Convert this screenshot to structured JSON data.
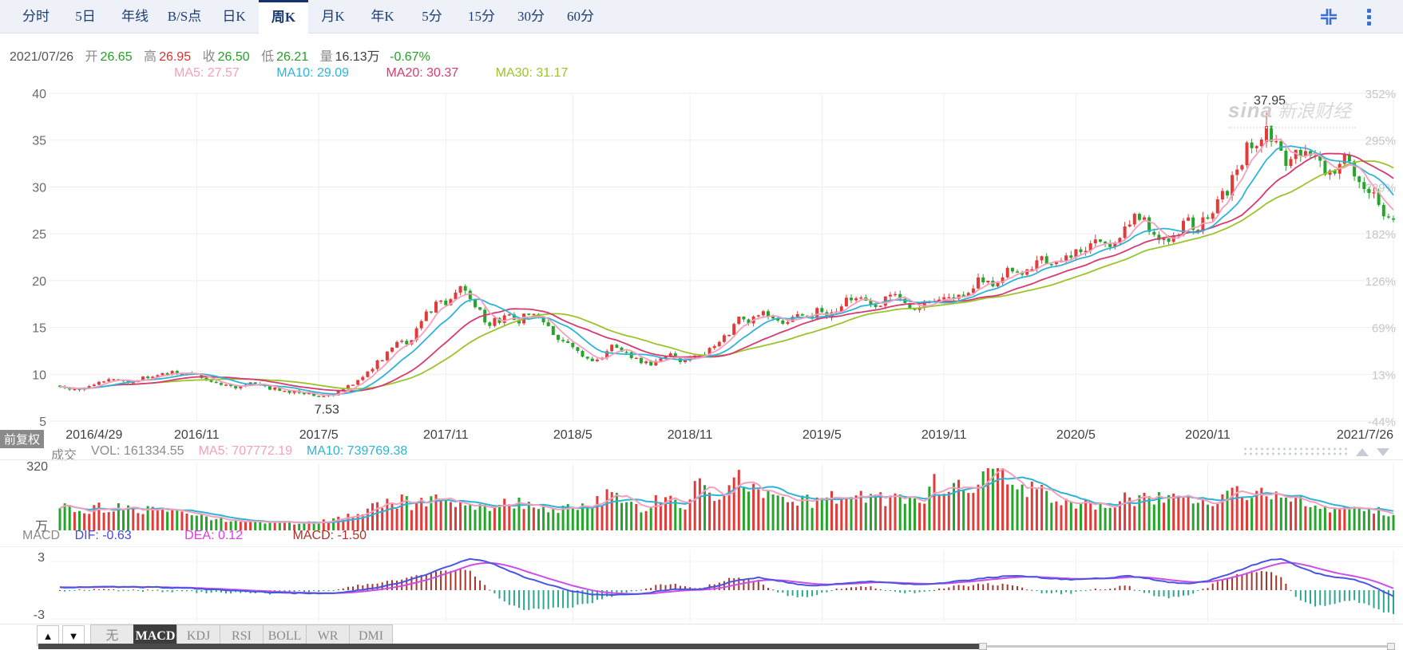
{
  "tab_bar": {
    "tabs": [
      {
        "key": "time",
        "label": "分时",
        "active": false
      },
      {
        "key": "5d",
        "label": "5日",
        "active": false
      },
      {
        "key": "yearline",
        "label": "年线",
        "active": false
      },
      {
        "key": "bs-point",
        "label": "B/S点",
        "active": false
      },
      {
        "key": "daily-k",
        "label": "日K",
        "active": false
      },
      {
        "key": "weekly-k",
        "label": "周K",
        "active": true
      },
      {
        "key": "monthly-k",
        "label": "月K",
        "active": false
      },
      {
        "key": "yearly-k",
        "label": "年K",
        "active": false
      },
      {
        "key": "5min",
        "label": "5分",
        "active": false
      },
      {
        "key": "15min",
        "label": "15分",
        "active": false
      },
      {
        "key": "30min",
        "label": "30分",
        "active": false
      },
      {
        "key": "60min",
        "label": "60分",
        "active": false
      }
    ]
  },
  "quote": {
    "date": "2021/07/26",
    "open_label": "开",
    "open": "26.65",
    "high_label": "高",
    "high": "26.95",
    "close_label": "收",
    "close": "26.50",
    "low_label": "低",
    "low": "26.21",
    "vol_label": "量",
    "vol": "16.13万",
    "change": "-0.67%"
  },
  "ma_legend": {
    "ma5": "MA5: 27.57",
    "ma10": "MA10: 29.09",
    "ma20": "MA20: 30.37",
    "ma30": "MA30: 31.17"
  },
  "adjust_badge": "前复权",
  "watermark": {
    "brand": "sina",
    "name": "新浪财经"
  },
  "volume_pane": {
    "title": "成交",
    "vol": "VOL: 161334.55",
    "ma5": "MA5: 707772.19",
    "ma10": "MA10: 739769.38",
    "axis_top": "320",
    "unit": "万"
  },
  "macd_pane": {
    "title": "MACD",
    "dif": "DIF: -0.63",
    "dea": "DEA: 0.12",
    "macd": "MACD: -1.50",
    "axis_top": "3",
    "axis_bottom": "-3"
  },
  "indicator_bar": {
    "up": "▲",
    "down": "▼",
    "items": [
      {
        "key": "none",
        "label": "无",
        "active": false
      },
      {
        "key": "macd",
        "label": "MACD",
        "active": true
      },
      {
        "key": "kdj",
        "label": "KDJ",
        "active": false
      },
      {
        "key": "rsi",
        "label": "RSI",
        "active": false
      },
      {
        "key": "boll",
        "label": "BOLL",
        "active": false
      },
      {
        "key": "wr",
        "label": "WR",
        "active": false
      },
      {
        "key": "dmi",
        "label": "DMI",
        "active": false
      }
    ]
  },
  "colors": {
    "up": "#e13b3a",
    "down": "#25a52b",
    "ma5": "#f4a0bd",
    "ma10": "#2db4d8",
    "ma20": "#d63a72",
    "ma30": "#9cc32a",
    "dif_line": "#4a55e0",
    "dea_line": "#cc4fe6",
    "hist_pos": "#a8352a",
    "hist_neg": "#2aa78c",
    "grid": "#ededed",
    "vgrid": "#efefef"
  },
  "chart_data": {
    "type": "candlestick",
    "title": "周K weekly candlestick with volume and MACD panes",
    "weeks": 274,
    "last_candle": {
      "date": "2021/07/26",
      "open": 26.65,
      "high": 26.95,
      "low": 26.21,
      "close": 26.5,
      "volume_wan": 16.13,
      "change_pct": -0.67
    },
    "ma_values": {
      "MA5": 27.57,
      "MA10": 29.09,
      "MA20": 30.37,
      "MA30": 31.17
    },
    "macd_values": {
      "DIF": -0.63,
      "DEA": 0.12,
      "MACD": -1.5
    },
    "volume_values": {
      "VOL": 161334.55,
      "MA5": 707772.19,
      "MA10": 739769.38
    },
    "y_axis": [
      {
        "price": 40,
        "pct": "352%"
      },
      {
        "price": 35,
        "pct": "295%"
      },
      {
        "price": 30,
        "pct": "239%"
      },
      {
        "price": 25,
        "pct": "182%"
      },
      {
        "price": 20,
        "pct": "126%"
      },
      {
        "price": 15,
        "pct": "69%"
      },
      {
        "price": 10,
        "pct": "13%"
      },
      {
        "price": 5,
        "pct": "-44%"
      }
    ],
    "x_labels": [
      {
        "label": "2016/4/29",
        "week": 7
      },
      {
        "label": "2016/11",
        "week": 28
      },
      {
        "label": "2017/5",
        "week": 53
      },
      {
        "label": "2017/11",
        "week": 79
      },
      {
        "label": "2018/5",
        "week": 105
      },
      {
        "label": "2018/11",
        "week": 129
      },
      {
        "label": "2019/5",
        "week": 156
      },
      {
        "label": "2019/11",
        "week": 181
      },
      {
        "label": "2020/5",
        "week": 208
      },
      {
        "label": "2020/11",
        "week": 235
      },
      {
        "label": "2021/7/26",
        "week": 273
      }
    ],
    "grid_weeks": [
      28,
      53,
      79,
      105,
      129,
      156,
      181,
      208,
      235,
      273
    ],
    "annotations": {
      "high": {
        "label": "37.95",
        "price": 37.95,
        "week": 247
      },
      "low": {
        "label": "7.53",
        "price": 7.53,
        "week": 54
      }
    },
    "price_anchors": [
      [
        0,
        8.8
      ],
      [
        3,
        8.4
      ],
      [
        6,
        8.9
      ],
      [
        9,
        9.3
      ],
      [
        12,
        9.6
      ],
      [
        15,
        9.3
      ],
      [
        18,
        9.7
      ],
      [
        21,
        10.0
      ],
      [
        24,
        10.1
      ],
      [
        27,
        10.0
      ],
      [
        30,
        9.5
      ],
      [
        33,
        9.0
      ],
      [
        36,
        8.7
      ],
      [
        39,
        8.9
      ],
      [
        42,
        8.5
      ],
      [
        45,
        8.3
      ],
      [
        48,
        8.2
      ],
      [
        51,
        7.9
      ],
      [
        54,
        7.7
      ],
      [
        56,
        7.9
      ],
      [
        58,
        8.4
      ],
      [
        60,
        9.0
      ],
      [
        62,
        9.8
      ],
      [
        64,
        10.8
      ],
      [
        66,
        11.6
      ],
      [
        68,
        12.8
      ],
      [
        70,
        13.6
      ],
      [
        71,
        13.1
      ],
      [
        73,
        15.0
      ],
      [
        75,
        16.6
      ],
      [
        77,
        17.6
      ],
      [
        79,
        17.2
      ],
      [
        81,
        19.2
      ],
      [
        82,
        19.8
      ],
      [
        84,
        18.3
      ],
      [
        86,
        16.6
      ],
      [
        88,
        15.3
      ],
      [
        90,
        15.9
      ],
      [
        92,
        16.3
      ],
      [
        94,
        15.7
      ],
      [
        95,
        16.9
      ],
      [
        97,
        16.6
      ],
      [
        99,
        15.6
      ],
      [
        101,
        14.2
      ],
      [
        103,
        13.3
      ],
      [
        105,
        12.7
      ],
      [
        107,
        12.1
      ],
      [
        109,
        11.6
      ],
      [
        111,
        12.1
      ],
      [
        113,
        13.3
      ],
      [
        115,
        12.4
      ],
      [
        117,
        11.7
      ],
      [
        119,
        11.2
      ],
      [
        121,
        10.9
      ],
      [
        123,
        11.9
      ],
      [
        125,
        12.2
      ],
      [
        127,
        11.6
      ],
      [
        129,
        11.7
      ],
      [
        131,
        11.9
      ],
      [
        133,
        12.6
      ],
      [
        135,
        13.4
      ],
      [
        137,
        14.6
      ],
      [
        139,
        16.0
      ],
      [
        141,
        15.4
      ],
      [
        143,
        16.7
      ],
      [
        145,
        16.1
      ],
      [
        147,
        15.3
      ],
      [
        149,
        15.8
      ],
      [
        151,
        16.5
      ],
      [
        153,
        16.1
      ],
      [
        155,
        16.7
      ],
      [
        157,
        16.3
      ],
      [
        159,
        17.0
      ],
      [
        161,
        17.7
      ],
      [
        163,
        18.4
      ],
      [
        165,
        17.9
      ],
      [
        167,
        17.3
      ],
      [
        169,
        17.8
      ],
      [
        171,
        18.2
      ],
      [
        173,
        17.8
      ],
      [
        175,
        17.2
      ],
      [
        177,
        17.6
      ],
      [
        179,
        18.1
      ],
      [
        181,
        17.9
      ],
      [
        183,
        18.1
      ],
      [
        185,
        18.9
      ],
      [
        187,
        19.5
      ],
      [
        189,
        20.2
      ],
      [
        191,
        19.7
      ],
      [
        193,
        20.7
      ],
      [
        195,
        21.4
      ],
      [
        197,
        20.9
      ],
      [
        199,
        21.7
      ],
      [
        201,
        22.4
      ],
      [
        203,
        21.7
      ],
      [
        205,
        22.2
      ],
      [
        207,
        23.0
      ],
      [
        209,
        22.8
      ],
      [
        211,
        23.8
      ],
      [
        213,
        24.8
      ],
      [
        215,
        24.2
      ],
      [
        217,
        25.1
      ],
      [
        219,
        26.0
      ],
      [
        221,
        26.8
      ],
      [
        223,
        25.8
      ],
      [
        225,
        24.8
      ],
      [
        227,
        24.1
      ],
      [
        229,
        25.3
      ],
      [
        231,
        26.3
      ],
      [
        233,
        25.9
      ],
      [
        235,
        26.9
      ],
      [
        237,
        28.3
      ],
      [
        239,
        29.8
      ],
      [
        241,
        31.8
      ],
      [
        243,
        33.8
      ],
      [
        245,
        35.3
      ],
      [
        247,
        36.8
      ],
      [
        249,
        34.2
      ],
      [
        251,
        31.8
      ],
      [
        253,
        33.2
      ],
      [
        255,
        34.3
      ],
      [
        257,
        33.0
      ],
      [
        259,
        31.4
      ],
      [
        261,
        31.9
      ],
      [
        263,
        32.6
      ],
      [
        265,
        31.3
      ],
      [
        267,
        29.8
      ],
      [
        269,
        28.8
      ],
      [
        271,
        27.4
      ],
      [
        273,
        26.5
      ]
    ],
    "volume_axis_max": 320,
    "volume_anchors": [
      [
        0,
        130
      ],
      [
        6,
        110
      ],
      [
        12,
        120
      ],
      [
        18,
        100
      ],
      [
        24,
        95
      ],
      [
        27,
        75
      ],
      [
        32,
        55
      ],
      [
        38,
        45
      ],
      [
        44,
        40
      ],
      [
        50,
        38
      ],
      [
        54,
        45
      ],
      [
        58,
        70
      ],
      [
        62,
        100
      ],
      [
        66,
        130
      ],
      [
        70,
        150
      ],
      [
        73,
        130
      ],
      [
        75,
        160
      ],
      [
        78,
        140
      ],
      [
        81,
        150
      ],
      [
        84,
        130
      ],
      [
        87,
        110
      ],
      [
        90,
        130
      ],
      [
        93,
        145
      ],
      [
        96,
        130
      ],
      [
        99,
        110
      ],
      [
        102,
        100
      ],
      [
        105,
        115
      ],
      [
        108,
        130
      ],
      [
        111,
        160
      ],
      [
        113,
        185
      ],
      [
        116,
        140
      ],
      [
        119,
        120
      ],
      [
        122,
        150
      ],
      [
        125,
        165
      ],
      [
        128,
        140
      ],
      [
        131,
        240
      ],
      [
        133,
        170
      ],
      [
        136,
        150
      ],
      [
        139,
        295
      ],
      [
        141,
        220
      ],
      [
        143,
        190
      ],
      [
        146,
        160
      ],
      [
        149,
        140
      ],
      [
        152,
        155
      ],
      [
        155,
        145
      ],
      [
        158,
        165
      ],
      [
        161,
        175
      ],
      [
        164,
        185
      ],
      [
        167,
        160
      ],
      [
        170,
        155
      ],
      [
        173,
        150
      ],
      [
        176,
        145
      ],
      [
        179,
        230
      ],
      [
        182,
        200
      ],
      [
        185,
        210
      ],
      [
        188,
        240
      ],
      [
        190,
        270
      ],
      [
        193,
        318
      ],
      [
        195,
        260
      ],
      [
        197,
        230
      ],
      [
        200,
        200
      ],
      [
        203,
        175
      ],
      [
        206,
        150
      ],
      [
        209,
        135
      ],
      [
        212,
        125
      ],
      [
        215,
        130
      ],
      [
        218,
        155
      ],
      [
        221,
        165
      ],
      [
        224,
        130
      ],
      [
        227,
        210
      ],
      [
        230,
        150
      ],
      [
        233,
        135
      ],
      [
        236,
        140
      ],
      [
        239,
        175
      ],
      [
        242,
        195
      ],
      [
        245,
        185
      ],
      [
        247,
        190
      ],
      [
        250,
        170
      ],
      [
        253,
        150
      ],
      [
        256,
        130
      ],
      [
        259,
        110
      ],
      [
        262,
        95
      ],
      [
        265,
        100
      ],
      [
        268,
        105
      ],
      [
        271,
        90
      ],
      [
        273,
        85
      ]
    ],
    "macd_range": [
      -3,
      3
    ],
    "dif_anchors": [
      [
        0,
        0.3
      ],
      [
        10,
        0.35
      ],
      [
        20,
        0.3
      ],
      [
        27,
        0.2
      ],
      [
        35,
        0.0
      ],
      [
        45,
        -0.3
      ],
      [
        55,
        -0.35
      ],
      [
        60,
        -0.1
      ],
      [
        65,
        0.3
      ],
      [
        70,
        0.8
      ],
      [
        75,
        1.6
      ],
      [
        80,
        2.6
      ],
      [
        84,
        3.3
      ],
      [
        88,
        2.9
      ],
      [
        92,
        2.0
      ],
      [
        96,
        1.2
      ],
      [
        100,
        0.6
      ],
      [
        104,
        0.0
      ],
      [
        108,
        -0.4
      ],
      [
        112,
        -0.5
      ],
      [
        116,
        -0.45
      ],
      [
        120,
        -0.3
      ],
      [
        124,
        0.0
      ],
      [
        128,
        0.15
      ],
      [
        131,
        0.1
      ],
      [
        135,
        0.5
      ],
      [
        139,
        1.1
      ],
      [
        143,
        1.3
      ],
      [
        147,
        1.0
      ],
      [
        151,
        0.6
      ],
      [
        155,
        0.5
      ],
      [
        160,
        0.7
      ],
      [
        165,
        0.9
      ],
      [
        170,
        0.8
      ],
      [
        175,
        0.6
      ],
      [
        180,
        0.7
      ],
      [
        185,
        1.0
      ],
      [
        190,
        1.3
      ],
      [
        195,
        1.5
      ],
      [
        199,
        1.4
      ],
      [
        203,
        1.2
      ],
      [
        207,
        1.1
      ],
      [
        211,
        1.2
      ],
      [
        215,
        1.3
      ],
      [
        219,
        1.5
      ],
      [
        223,
        1.2
      ],
      [
        227,
        0.8
      ],
      [
        231,
        0.7
      ],
      [
        235,
        1.0
      ],
      [
        239,
        1.6
      ],
      [
        243,
        2.4
      ],
      [
        247,
        3.1
      ],
      [
        250,
        3.3
      ],
      [
        253,
        2.6
      ],
      [
        256,
        2.0
      ],
      [
        259,
        1.5
      ],
      [
        262,
        1.3
      ],
      [
        265,
        1.1
      ],
      [
        268,
        0.6
      ],
      [
        271,
        -0.2
      ],
      [
        273,
        -0.63
      ]
    ]
  }
}
